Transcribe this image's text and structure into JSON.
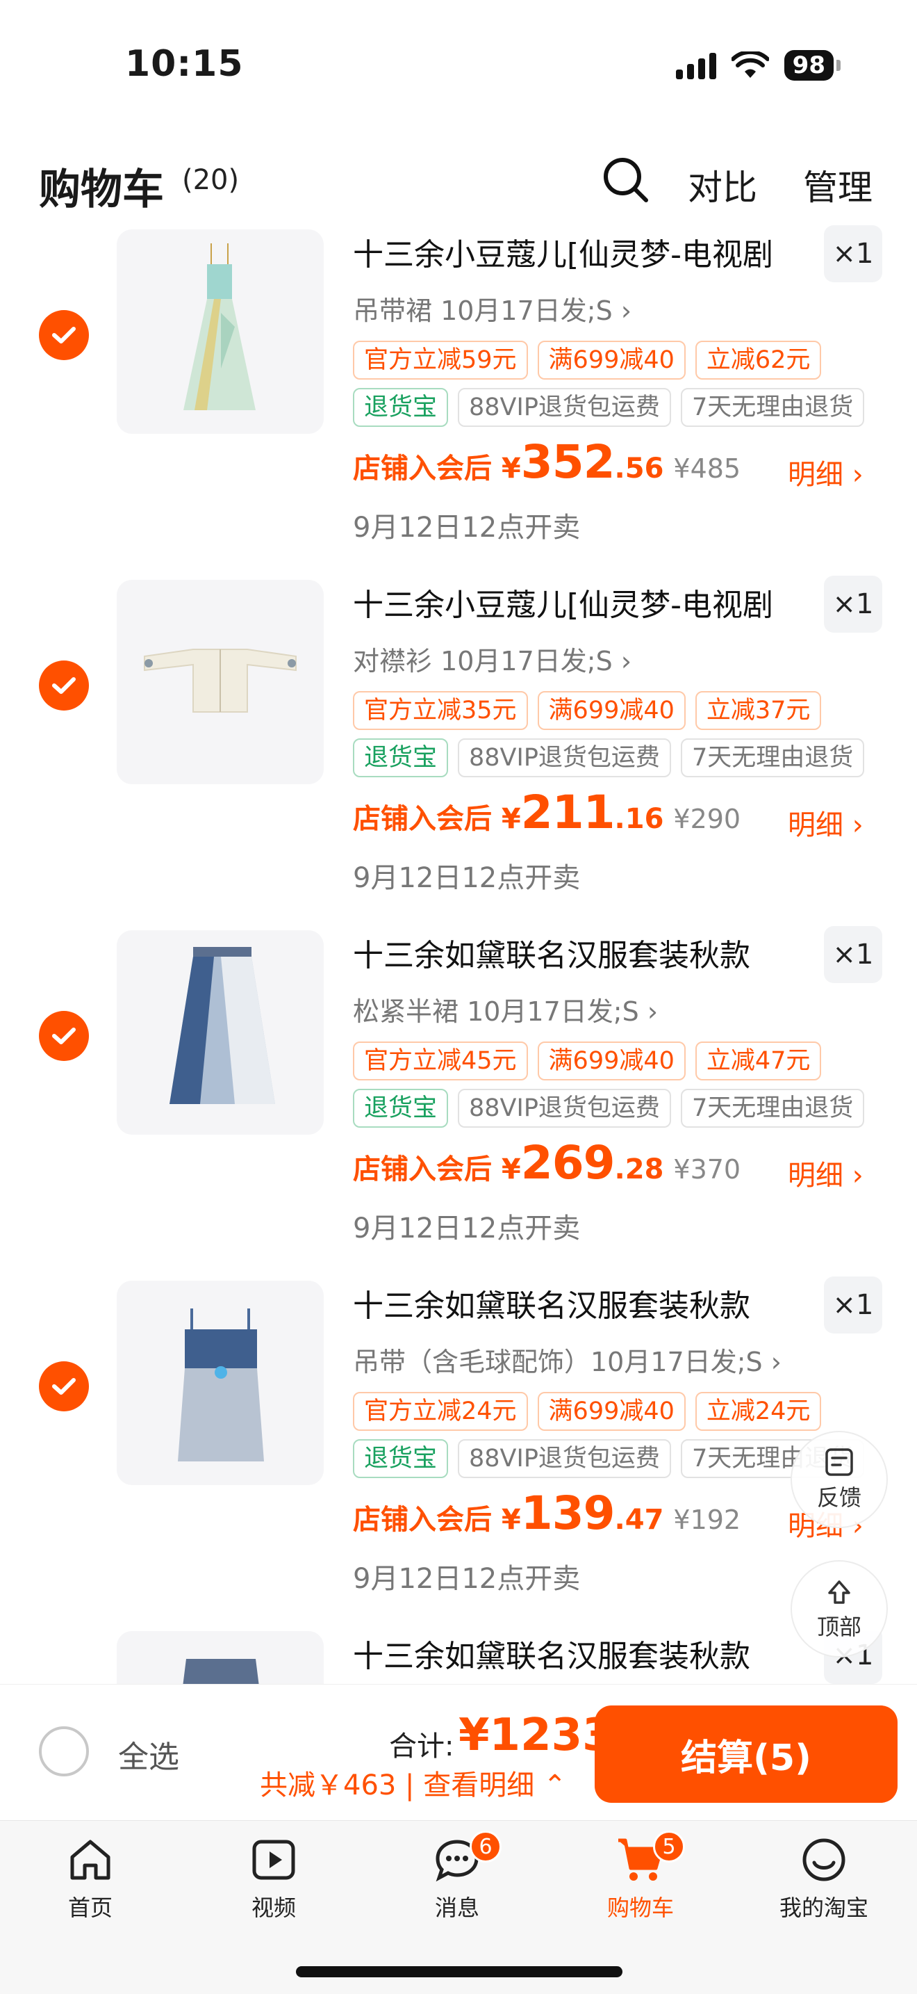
{
  "status_bar": {
    "time": "10:15",
    "battery": "98"
  },
  "header": {
    "title": "购物车",
    "count": "(20)",
    "compare": "对比",
    "manage": "管理"
  },
  "items": [
    {
      "title": "十三余小豆蔻儿[仙灵梦-电视剧",
      "quantity": "×1",
      "spec": "吊带裙 10月17日发;S",
      "promo_tags": [
        "官方立减59元",
        "满699减40",
        "立减62元"
      ],
      "service_tags": [
        "退货宝",
        "88VIP退货包运费",
        "7天无理由退货"
      ],
      "price_prefix": "店铺入会后 ¥",
      "price_int": "352",
      "price_dec": ".56",
      "original_price": "¥485",
      "detail": "明细",
      "sale_time": "9月12日12点开卖"
    },
    {
      "title": "十三余小豆蔻儿[仙灵梦-电视剧",
      "quantity": "×1",
      "spec": "对襟衫 10月17日发;S",
      "promo_tags": [
        "官方立减35元",
        "满699减40",
        "立减37元"
      ],
      "service_tags": [
        "退货宝",
        "88VIP退货包运费",
        "7天无理由退货"
      ],
      "price_prefix": "店铺入会后 ¥",
      "price_int": "211",
      "price_dec": ".16",
      "original_price": "¥290",
      "detail": "明细",
      "sale_time": "9月12日12点开卖"
    },
    {
      "title": "十三余如黛联名汉服套装秋款",
      "quantity": "×1",
      "spec": "松紧半裙 10月17日发;S",
      "promo_tags": [
        "官方立减45元",
        "满699减40",
        "立减47元"
      ],
      "service_tags": [
        "退货宝",
        "88VIP退货包运费",
        "7天无理由退货"
      ],
      "price_prefix": "店铺入会后 ¥",
      "price_int": "269",
      "price_dec": ".28",
      "original_price": "¥370",
      "detail": "明细",
      "sale_time": "9月12日12点开卖"
    },
    {
      "title": "十三余如黛联名汉服套装秋款",
      "quantity": "×1",
      "spec": "吊带（含毛球配饰）10月17日发;S",
      "promo_tags": [
        "官方立减24元",
        "满699减40",
        "立减24元"
      ],
      "service_tags": [
        "退货宝",
        "88VIP退货包运费",
        "7天无理由退货"
      ],
      "price_prefix": "店铺入会后 ¥",
      "price_int": "139",
      "price_dec": ".47",
      "original_price": "¥192",
      "detail": "明细",
      "sale_time": "9月12日12点开卖"
    },
    {
      "title": "十三余如黛联名汉服套装秋款",
      "quantity": "×1"
    }
  ],
  "floating": {
    "feedback": "反馈",
    "top": "顶部"
  },
  "checkout": {
    "select_all": "全选",
    "total_label": "合计:",
    "total_value": "¥1233",
    "saving": "共减￥463 | 查看明细",
    "button": "结算(5)"
  },
  "tabs": [
    {
      "label": "首页",
      "icon": "home-icon"
    },
    {
      "label": "视频",
      "icon": "video-icon"
    },
    {
      "label": "消息",
      "icon": "message-icon",
      "badge": "6"
    },
    {
      "label": "购物车",
      "icon": "cart-icon",
      "badge": "5",
      "active": true
    },
    {
      "label": "我的淘宝",
      "icon": "profile-icon"
    }
  ],
  "colors": {
    "accent": "#ff5000",
    "green": "#19a15f"
  }
}
